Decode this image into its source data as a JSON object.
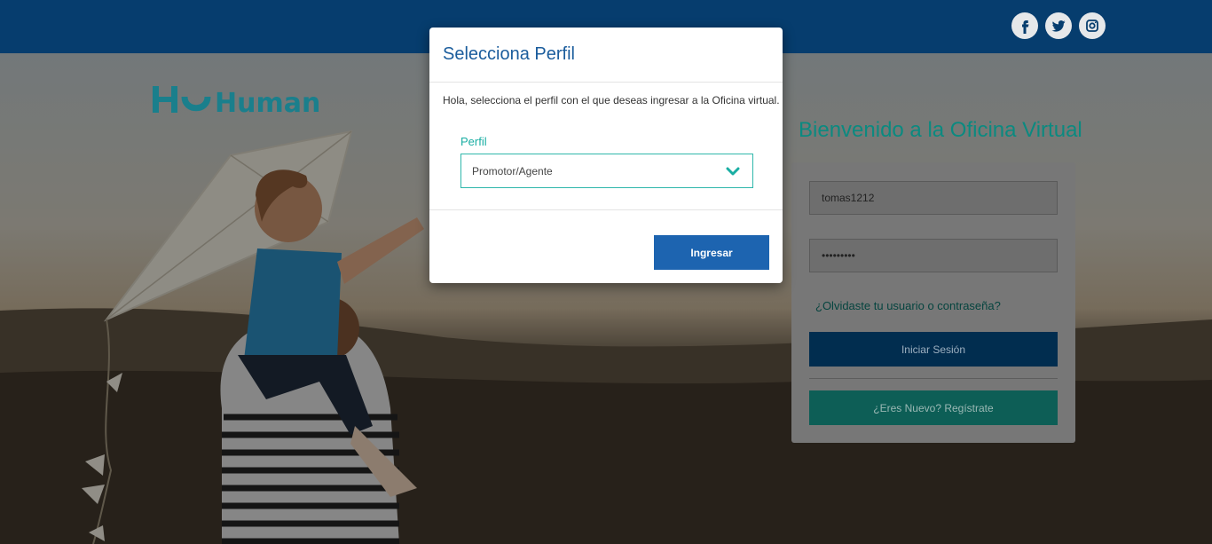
{
  "brand": {
    "logo_text": "Humano"
  },
  "social": {
    "icons": [
      "facebook-icon",
      "twitter-icon",
      "instagram-icon"
    ]
  },
  "login": {
    "welcome_title": "Bienvenido a la Oficina Virtual",
    "username_value": "tomas1212",
    "password_value": "•••••••••",
    "forgot_link": "¿Olvidaste tu usuario o contraseña?",
    "signin_button": "Iniciar Sesión",
    "register_button": "¿Eres Nuevo? Regístrate"
  },
  "modal": {
    "title": "Selecciona Perfil",
    "description": "Hola, selecciona el perfil con el que deseas ingresar a la Oficina virtual.",
    "profile_label": "Perfil",
    "profile_selected": "Promotor/Agente",
    "submit_button": "Ingresar"
  },
  "colors": {
    "topbar": "#063d6e",
    "brand_teal": "#1aaea3",
    "primary_blue": "#1d64b0"
  }
}
